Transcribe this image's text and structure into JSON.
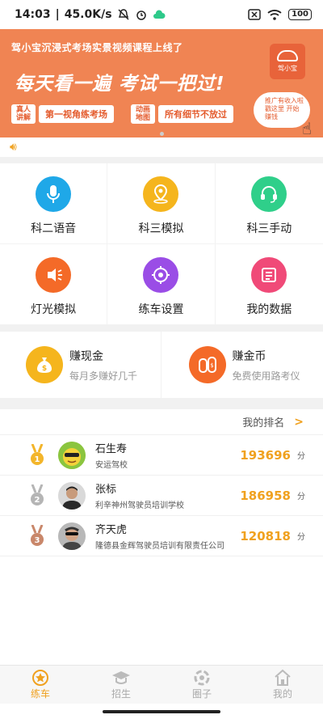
{
  "statusbar": {
    "time": "14:03",
    "speed": "45.0K/s",
    "battery": "100"
  },
  "banner": {
    "topline": "驾小宝沉浸式考场实景视频课程上线了",
    "headline": "每天看一遍  考试一把过!",
    "logo_text": "驾小宝",
    "tag1_small": "真人讲解",
    "tag1_main": "第一视角练考场",
    "tag2_small": "动画地图",
    "tag2_main": "所有细节不放过",
    "promo": "推广有收入啦 戳这里 开始赚钱"
  },
  "grid": {
    "items": [
      {
        "label": "科二语音",
        "color": "#1fa8e8",
        "icon": "microphone-icon"
      },
      {
        "label": "科三模拟",
        "color": "#f5b51d",
        "icon": "location-pin-icon"
      },
      {
        "label": "科三手动",
        "color": "#2fcf8a",
        "icon": "headset-icon"
      },
      {
        "label": "灯光模拟",
        "color": "#f46a28",
        "icon": "lamp-icon"
      },
      {
        "label": "练车设置",
        "color": "#9a4de6",
        "icon": "settings-icon"
      },
      {
        "label": "我的数据",
        "color": "#f04a78",
        "icon": "data-list-icon"
      }
    ]
  },
  "earn": {
    "cash_title": "赚现金",
    "cash_sub": "每月多赚好几千",
    "coin_title": "赚金币",
    "coin_sub": "免费使用路考仪"
  },
  "ranking": {
    "title": "我的排名",
    "unit": "分",
    "rows": [
      {
        "rank": "1",
        "name": "石生寿",
        "school": "安运驾校",
        "score": "193696",
        "medal": "#f3b52a"
      },
      {
        "rank": "2",
        "name": "张标",
        "school": "利辛神州驾驶员培训学校",
        "score": "186958",
        "medal": "#b5b5b5"
      },
      {
        "rank": "3",
        "name": "齐天虎",
        "school": "隆德县金辉驾驶员培训有限责任公司",
        "score": "120818",
        "medal": "#c9876a"
      }
    ]
  },
  "nav": {
    "items": [
      {
        "label": "练车",
        "icon": "star-badge-icon",
        "active": true
      },
      {
        "label": "招生",
        "icon": "graduation-cap-icon",
        "active": false
      },
      {
        "label": "圈子",
        "icon": "circle-logo-icon",
        "active": false
      },
      {
        "label": "我的",
        "icon": "home-icon",
        "active": false
      }
    ]
  },
  "colors": {
    "accent": "#f0a11f",
    "banner": "#f08453"
  }
}
